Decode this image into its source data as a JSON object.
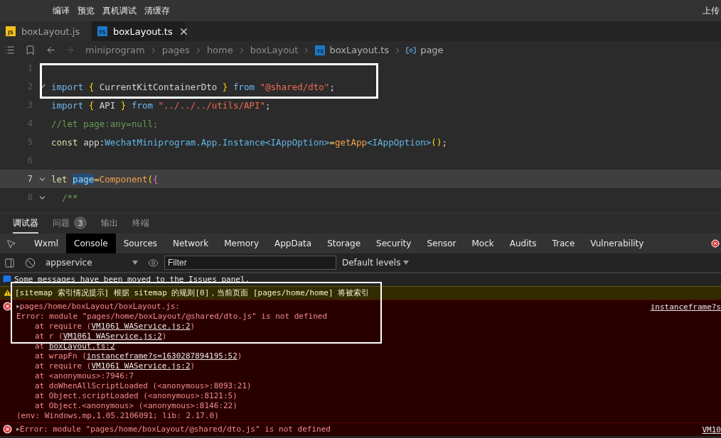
{
  "toolbar": {
    "actions": [
      "编译",
      "预览",
      "真机调试",
      "清缓存"
    ],
    "right_action": "上传"
  },
  "editor_tabs": [
    {
      "label": "boxLayout.js",
      "file_type": "JS",
      "selected": false
    },
    {
      "label": "boxLayout.ts",
      "file_type": "TS",
      "selected": true
    }
  ],
  "breadcrumb": [
    {
      "label": "miniprogram",
      "kind": "folder"
    },
    {
      "label": "pages",
      "kind": "folder"
    },
    {
      "label": "home",
      "kind": "folder"
    },
    {
      "label": "boxLayout",
      "kind": "folder"
    },
    {
      "label": "boxLayout.ts",
      "kind": "ts-file",
      "file_type": "TS"
    },
    {
      "label": "page",
      "kind": "symbol"
    }
  ],
  "code_lines": [
    {
      "number": "1",
      "current": false,
      "foldable": false,
      "changed": false
    },
    {
      "number": "2",
      "current": false,
      "foldable": false,
      "changed": true,
      "tokens": [
        {
          "text": "import ",
          "kind": "keyword"
        },
        {
          "text": "{",
          "kind": "brace"
        },
        {
          "text": " CurrentKitContainerDto ",
          "kind": "plain"
        },
        {
          "text": "}",
          "kind": "brace"
        },
        {
          "text": " from ",
          "kind": "keyword"
        },
        {
          "text": "\"@shared/dto\"",
          "kind": "string"
        },
        {
          "text": ";",
          "kind": "plain"
        }
      ]
    },
    {
      "number": "3",
      "current": false,
      "foldable": false,
      "changed": false,
      "tokens": [
        {
          "text": "import ",
          "kind": "keyword"
        },
        {
          "text": "{",
          "kind": "brace"
        },
        {
          "text": " API ",
          "kind": "plain"
        },
        {
          "text": "}",
          "kind": "brace"
        },
        {
          "text": " from ",
          "kind": "keyword"
        },
        {
          "text": "\"../../../utils/API\"",
          "kind": "string"
        },
        {
          "text": ";",
          "kind": "plain"
        }
      ]
    },
    {
      "number": "4",
      "current": false,
      "foldable": false,
      "changed": false,
      "tokens": [
        {
          "text": "//let page:any=null;",
          "kind": "comment"
        }
      ]
    },
    {
      "number": "5",
      "current": false,
      "foldable": false,
      "changed": false,
      "tokens": [
        {
          "text": "const",
          "kind": "storage"
        },
        {
          "text": " app:",
          "kind": "plain"
        },
        {
          "text": "WechatMiniprogram.App.Instance<IAppOption>",
          "kind": "type"
        },
        {
          "text": "=",
          "kind": "operator"
        },
        {
          "text": "getApp",
          "kind": "function"
        },
        {
          "text": "<IAppOption>",
          "kind": "type"
        },
        {
          "text": "()",
          "kind": "brace"
        },
        {
          "text": ";",
          "kind": "plain"
        }
      ]
    },
    {
      "number": "6",
      "current": false,
      "foldable": false,
      "changed": false
    },
    {
      "number": "7",
      "current": true,
      "foldable": true,
      "changed": false,
      "tokens": [
        {
          "text": "let ",
          "kind": "storage"
        },
        {
          "text": "page",
          "kind": "selection"
        },
        {
          "text": "=",
          "kind": "operator"
        },
        {
          "text": "Component",
          "kind": "function"
        },
        {
          "text": "(",
          "kind": "brace"
        },
        {
          "text": "{",
          "kind": "brace2"
        }
      ]
    },
    {
      "number": "8",
      "current": false,
      "foldable": true,
      "changed": false,
      "tokens": [
        {
          "text": "  /**",
          "kind": "comment"
        }
      ]
    }
  ],
  "devtools_tabs": [
    {
      "label": "调试器",
      "selected": true
    },
    {
      "label": "问题",
      "selected": false,
      "badge": "3"
    },
    {
      "label": "输出",
      "selected": false
    },
    {
      "label": "终端",
      "selected": false
    }
  ],
  "panel_tabs": [
    {
      "label": "Wxml",
      "selected": false
    },
    {
      "label": "Console",
      "selected": true
    },
    {
      "label": "Sources",
      "selected": false
    },
    {
      "label": "Network",
      "selected": false
    },
    {
      "label": "Memory",
      "selected": false
    },
    {
      "label": "AppData",
      "selected": false
    },
    {
      "label": "Storage",
      "selected": false
    },
    {
      "label": "Security",
      "selected": false
    },
    {
      "label": "Sensor",
      "selected": false
    },
    {
      "label": "Mock",
      "selected": false
    },
    {
      "label": "Audits",
      "selected": false
    },
    {
      "label": "Trace",
      "selected": false
    },
    {
      "label": "Vulnerability",
      "selected": false
    }
  ],
  "console_toolbar": {
    "context": "appservice",
    "filter_placeholder": "Filter",
    "levels": "Default levels"
  },
  "messages": [
    {
      "kind": "info",
      "text": "Some messages have been moved to the Issues panel."
    },
    {
      "kind": "warning",
      "text": "[sitemap 索引情况提示] 根据 sitemap 的规则[0]，当前页面 [pages/home/home] 将被索引"
    },
    {
      "kind": "error",
      "toggle": "▶",
      "source": "instanceframe?s",
      "lines": [
        {
          "kind": "message",
          "parts": [
            {
              "text": "pages/home/boxLayout/boxLayout.js:",
              "link": false
            }
          ]
        },
        {
          "kind": "message",
          "parts": [
            {
              "text": "Error: module \"pages/home/boxLayout/@shared/dto.js\" is not defined",
              "link": false
            }
          ]
        },
        {
          "kind": "frame",
          "parts": [
            {
              "text": "at require (",
              "link": false
            },
            {
              "text": "VM1061 WAService.js:2",
              "link": true
            },
            {
              "text": ")",
              "link": false
            }
          ]
        },
        {
          "kind": "frame",
          "parts": [
            {
              "text": "at r (",
              "link": false
            },
            {
              "text": "VM1061 WAService.js:2",
              "link": true
            },
            {
              "text": ")",
              "link": false
            }
          ]
        },
        {
          "kind": "frame",
          "parts": [
            {
              "text": "at ",
              "link": false
            },
            {
              "text": "boxLayout.ts:2",
              "link": true
            }
          ]
        },
        {
          "kind": "frame",
          "parts": [
            {
              "text": "at wrapFn (",
              "link": false
            },
            {
              "text": "instanceframe?s=1630287894195:52",
              "link": true
            },
            {
              "text": ")",
              "link": false
            }
          ]
        },
        {
          "kind": "frame",
          "parts": [
            {
              "text": "at require (",
              "link": false
            },
            {
              "text": "VM1061 WAService.js:2",
              "link": true
            },
            {
              "text": ")",
              "link": false
            }
          ]
        },
        {
          "kind": "frame",
          "parts": [
            {
              "text": "at <anonymous>:7946:7",
              "link": false
            }
          ]
        },
        {
          "kind": "frame",
          "parts": [
            {
              "text": "at doWhenAllScriptLoaded (<anonymous>:8093:21)",
              "link": false
            }
          ]
        },
        {
          "kind": "frame",
          "parts": [
            {
              "text": "at Object.scriptLoaded (<anonymous>:8121:5)",
              "link": false
            }
          ]
        },
        {
          "kind": "frame",
          "parts": [
            {
              "text": "at Object.<anonymous> (<anonymous>:8146:22)",
              "link": false
            }
          ]
        },
        {
          "kind": "message",
          "parts": [
            {
              "text": "(env: Windows,mp,1.05.2106091; lib: 2.17.0)",
              "link": false
            }
          ]
        }
      ]
    },
    {
      "kind": "error",
      "toggle": "▶",
      "source": "VM10",
      "lines": [
        {
          "kind": "message",
          "parts": [
            {
              "text": "Error: module \"pages/home/boxLayout/@shared/dto.js\" is not defined",
              "link": false
            }
          ]
        }
      ]
    }
  ]
}
